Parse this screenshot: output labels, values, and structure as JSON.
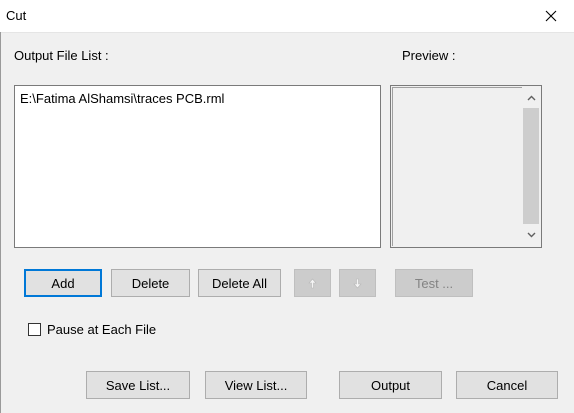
{
  "window": {
    "title": "Cut",
    "close_icon": "close-icon"
  },
  "labels": {
    "output_file_list": "Output File List :",
    "preview": "Preview :"
  },
  "file_list": {
    "items": [
      "E:\\Fatima AlShamsi\\traces PCB.rml"
    ]
  },
  "buttons": {
    "add": "Add",
    "delete": "Delete",
    "delete_all": "Delete All",
    "test": "Test ...",
    "save_list": "Save List...",
    "view_list": "View List...",
    "output": "Output",
    "cancel": "Cancel"
  },
  "icons": {
    "move_up": "arrow-up-icon",
    "move_down": "arrow-down-icon"
  },
  "checkbox": {
    "pause_label": "Pause at Each File",
    "checked": false
  },
  "colors": {
    "accent": "#0078d7",
    "dialog_bg": "#f0f0f0",
    "button_bg": "#e1e1e1",
    "disabled_bg": "#cccccc",
    "disabled_text": "#838383"
  }
}
